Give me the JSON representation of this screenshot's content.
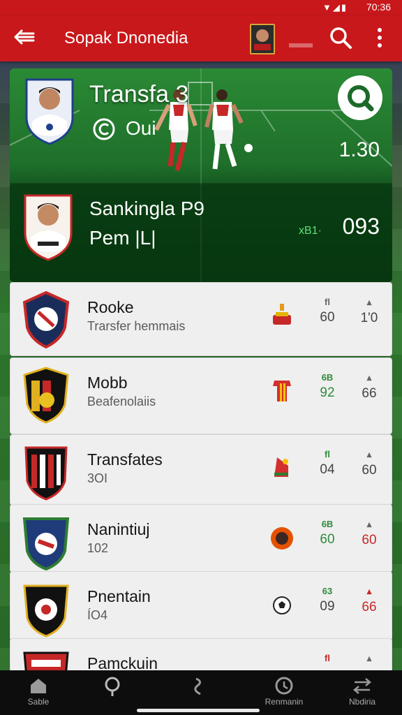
{
  "status": {
    "time": "70:36"
  },
  "header": {
    "title": "Sopak Dnonedia"
  },
  "featured": [
    {
      "title": "Transfa 3",
      "subtitle": "Oui",
      "value": "1.30"
    },
    {
      "line1": "Sankingla P9",
      "line2": "Pem |L|",
      "tag": "xB1·",
      "value": "093"
    }
  ],
  "list": [
    {
      "name": "Rooke",
      "sub": "Trarsfer hemmais",
      "stat1_label": "fl",
      "stat1": "60",
      "stat2_label": "▴",
      "stat2": "1'0"
    },
    {
      "name": "Mobb",
      "sub": "Beafenolaiis",
      "stat1_label": "6B",
      "stat1": "92",
      "stat2_label": "▴",
      "stat2": "66"
    },
    {
      "name": "Transfates",
      "sub": "3ОІ",
      "stat1_label": "fl",
      "stat1": "04",
      "stat2_label": "▴",
      "stat2": "60"
    },
    {
      "name": "Nanintiuj",
      "sub": "102",
      "stat1_label": "6B",
      "stat1": "60",
      "stat2_label": "▴",
      "stat2": "60"
    },
    {
      "name": "Pnentain",
      "sub": "ÍO4",
      "stat1_label": "63",
      "stat1": "09",
      "stat2_label": "▴",
      "stat2": "66"
    },
    {
      "name": "Pamckuin",
      "sub": "",
      "stat1_label": "fl",
      "stat1": "",
      "stat2_label": "▴",
      "stat2": ""
    }
  ],
  "nav": [
    {
      "label": "Sable",
      "icon": "home-icon"
    },
    {
      "label": "",
      "icon": "search-pin-icon"
    },
    {
      "label": "",
      "icon": "transfer-icon"
    },
    {
      "label": "Renmanin",
      "icon": "clock-icon"
    },
    {
      "label": "Nbdiria",
      "icon": "swap-icon"
    }
  ],
  "colors": {
    "appbar": "#c8181b",
    "accent_green": "#2e8b3a",
    "accent_red": "#c62828"
  }
}
